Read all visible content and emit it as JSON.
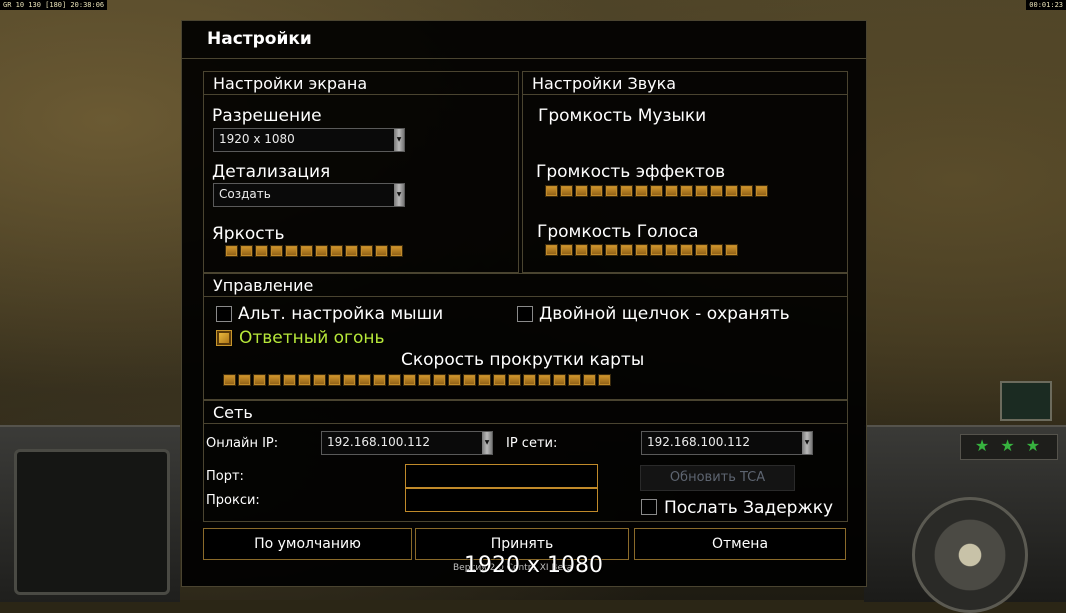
{
  "hud": {
    "top_left_stats": "GR 10 130 [180] 20:38:06",
    "top_right_time": "00:01:23",
    "stars": "★ ★ ★"
  },
  "dialog": {
    "title": "Настройки",
    "screen": {
      "header": "Настройки экрана",
      "resolution_label": "Разрешение",
      "resolution_value": "1920 x 1080",
      "detail_label": "Детализация",
      "detail_value": "Создать",
      "brightness_label": "Яркость",
      "brightness_segments": 12
    },
    "sound": {
      "header": "Настройки Звука",
      "music_label": "Громкость Музыки",
      "effects_label": "Громкость эффектов",
      "effects_segments": 15,
      "voice_label": "Громкость Голоса",
      "voice_segments": 13
    },
    "control": {
      "header": "Управление",
      "alt_mouse_label": "Альт. настройка мыши",
      "alt_mouse_checked": false,
      "double_click_label": "Двойной щелчок - охранять",
      "double_click_checked": false,
      "return_fire_label": "Ответный огонь",
      "return_fire_checked": true,
      "return_fire_color": "#b7e83a",
      "scroll_speed_label": "Скорость прокрутки карты",
      "scroll_segments": 26
    },
    "network": {
      "header": "Сеть",
      "online_ip_label": "Онлайн IP:",
      "online_ip_value": "192.168.100.112",
      "lan_ip_label": "IP сети:",
      "lan_ip_value": "192.168.100.112",
      "port_label": "Порт:",
      "port_value": "",
      "proxy_label": "Прокси:",
      "proxy_value": "",
      "update_tca_label": "Обновить TCA",
      "send_delay_label": "Послать Задержку",
      "send_delay_checked": false
    },
    "buttons": {
      "defaults": "По умолчанию",
      "accept": "Принять",
      "cancel": "Отмена"
    }
  },
  "overlay": {
    "resolution_text": "1920 x 1080",
    "version_text": "Версия 2.0 Contra XI Beta"
  },
  "colors": {
    "accent_orange": "#c08a2a",
    "panel_border": "#4a4430",
    "disabled_text": "#5d6470"
  }
}
